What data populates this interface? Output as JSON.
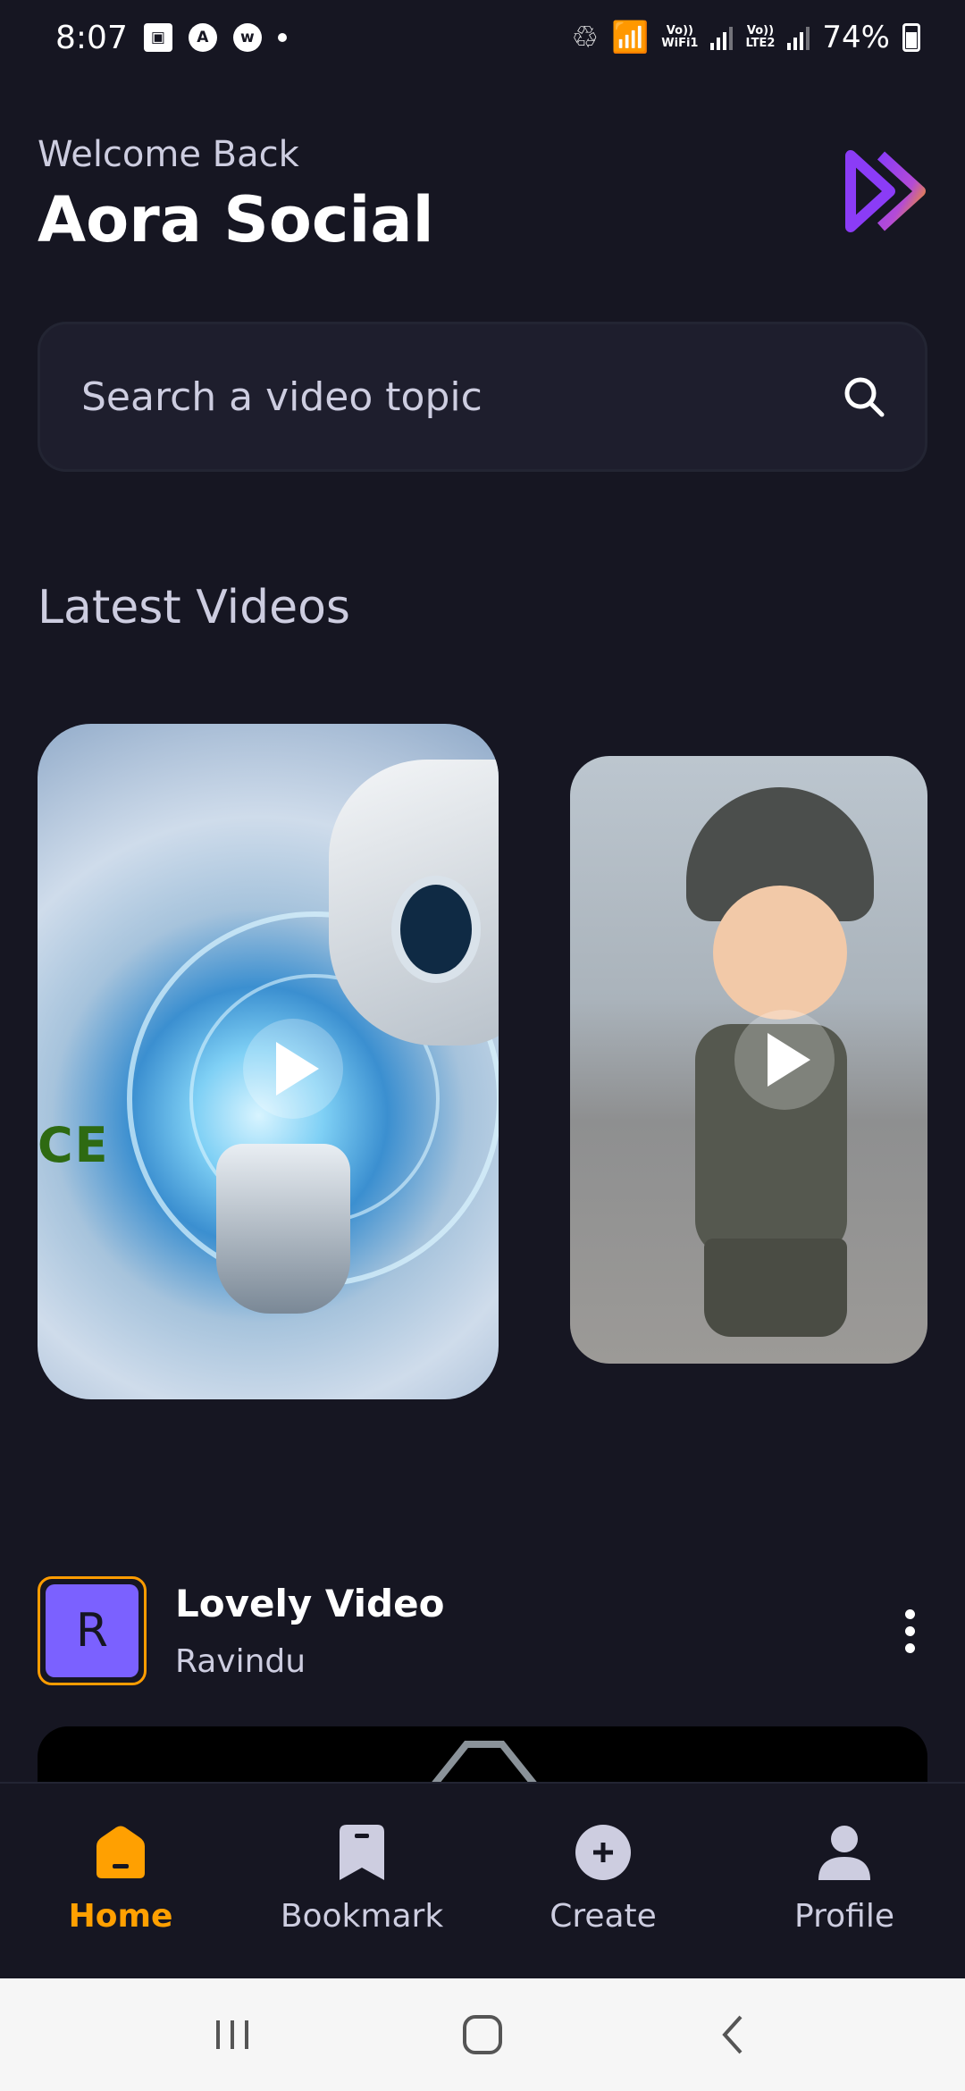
{
  "status_bar": {
    "time": "8:07",
    "network_1": "Vo))\nWiFi1",
    "network_2": "Vo))\nLTE2",
    "battery": "74%"
  },
  "header": {
    "welcome": "Welcome Back",
    "title": "Aora Social",
    "logo": "aora-logo",
    "accent_colors": [
      "#8B3CF6",
      "#FFA001"
    ]
  },
  "search": {
    "placeholder": "Search a video topic",
    "icon": "search-icon"
  },
  "latest": {
    "title": "Latest Videos",
    "cards": [
      {
        "thumbnail": "robot-hand-hologram",
        "edge_text": "CE"
      },
      {
        "thumbnail": "cartoon-soldier"
      }
    ]
  },
  "video": {
    "avatar_letter": "R",
    "title": "Lovely Video",
    "creator": "Ravindu"
  },
  "tabs": [
    {
      "label": "Home",
      "icon": "home-icon",
      "active": true
    },
    {
      "label": "Bookmark",
      "icon": "bookmark-icon",
      "active": false
    },
    {
      "label": "Create",
      "icon": "plus-circle-icon",
      "active": false
    },
    {
      "label": "Profile",
      "icon": "profile-icon",
      "active": false
    }
  ],
  "colors": {
    "background": "#161622",
    "accent": "#FFA001",
    "text_secondary": "#CDCDE0",
    "avatar_bg": "#7B61FF"
  }
}
